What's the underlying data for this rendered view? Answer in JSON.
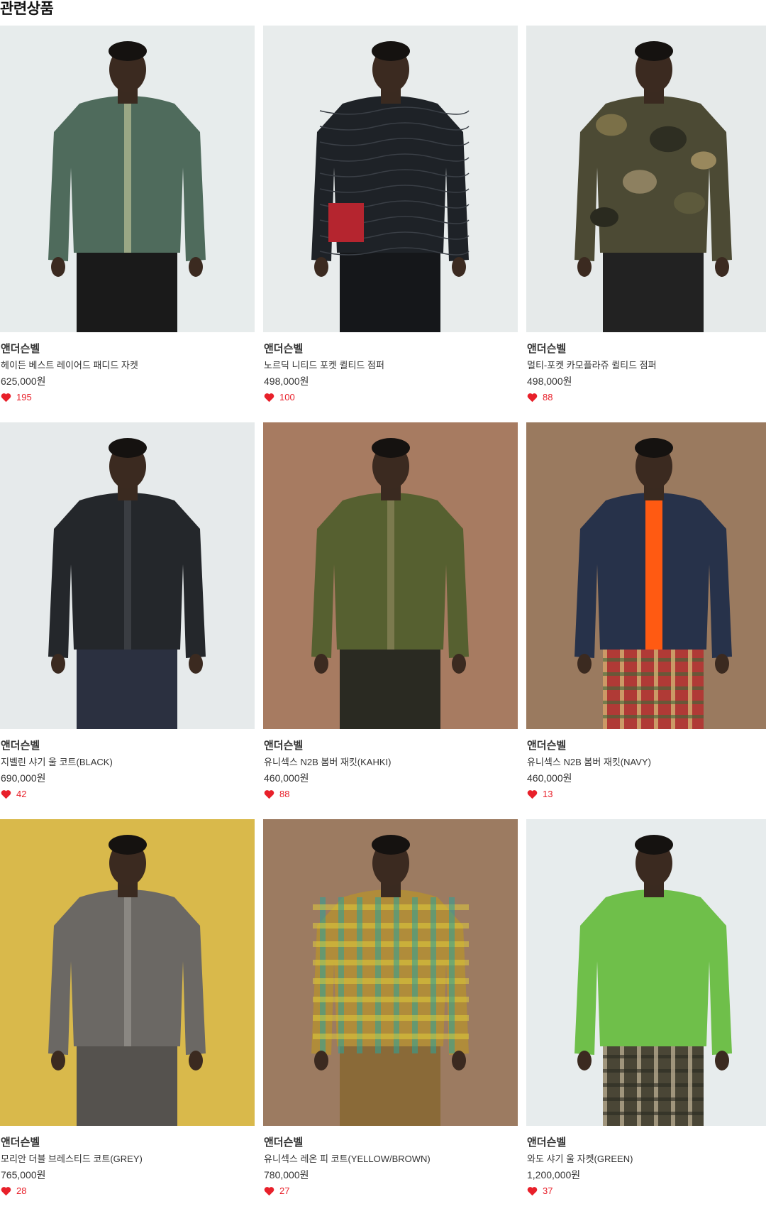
{
  "section": {
    "title": "관련상품"
  },
  "products": [
    {
      "brand": "앤더슨벨",
      "name": "헤이든 베스트 레이어드 패디드 자켓",
      "price": "625,000원",
      "likes": "195",
      "image": {
        "bg": "#e7ecec",
        "body": "#4f6b5c",
        "accent": "#9aa785",
        "lower": "#1a1a1a",
        "pattern": "none"
      }
    },
    {
      "brand": "앤더슨벨",
      "name": "노르딕 니티드 포켓 퀼티드 점퍼",
      "price": "498,000원",
      "likes": "100",
      "image": {
        "bg": "#e8ecec",
        "body": "#1e2227",
        "accent": "#b5252f",
        "lower": "#15171a",
        "pattern": "quilt"
      }
    },
    {
      "brand": "앤더슨벨",
      "name": "멀티-포켓 카모플라쥬 퀼티드 점퍼",
      "price": "498,000원",
      "likes": "88",
      "image": {
        "bg": "#e6eaea",
        "body": "#4c4a34",
        "accent": "#2a2a1f",
        "lower": "#222222",
        "pattern": "camo"
      }
    },
    {
      "brand": "앤더슨벨",
      "name": "지벨린 샤기 울 코트(BLACK)",
      "price": "690,000원",
      "likes": "42",
      "image": {
        "bg": "#e6eaeb",
        "body": "#24272b",
        "accent": "#3a3d42",
        "lower": "#2b3040",
        "pattern": "none"
      }
    },
    {
      "brand": "앤더슨벨",
      "name": "유니섹스 N2B 봄버 재킷(KAHKI)",
      "price": "460,000원",
      "likes": "88",
      "image": {
        "bg": "#a77b61",
        "body": "#566030",
        "accent": "#7b7a4e",
        "lower": "#2a2a22",
        "pattern": "none"
      }
    },
    {
      "brand": "앤더슨벨",
      "name": "유니섹스 N2B 봄버 재킷(NAVY)",
      "price": "460,000원",
      "likes": "13",
      "image": {
        "bg": "#9a7a5f",
        "body": "#27324a",
        "accent": "#ff5a12",
        "lower": "#b03a36",
        "pattern": "plaid"
      }
    },
    {
      "brand": "앤더슨벨",
      "name": "모리안 더블 브레스티드 코트(GREY)",
      "price": "765,000원",
      "likes": "28",
      "image": {
        "bg": "#d9b94b",
        "body": "#6b6864",
        "accent": "#8a8782",
        "lower": "#55524e",
        "pattern": "none"
      }
    },
    {
      "brand": "앤더슨벨",
      "name": "유니섹스 레온 피 코트(YELLOW/BROWN)",
      "price": "780,000원",
      "likes": "27",
      "image": {
        "bg": "#9c7b61",
        "body": "#b08c3a",
        "accent": "#2aa39a",
        "lower": "#8a6a38",
        "pattern": "check"
      }
    },
    {
      "brand": "앤더슨벨",
      "name": "와도 샤기 울 자켓(GREEN)",
      "price": "1,200,000원",
      "likes": "37",
      "image": {
        "bg": "#e7eced",
        "body": "#6fbf4a",
        "accent": "#5aa93a",
        "lower": "#4a4636",
        "pattern": "camo-lower"
      }
    }
  ]
}
